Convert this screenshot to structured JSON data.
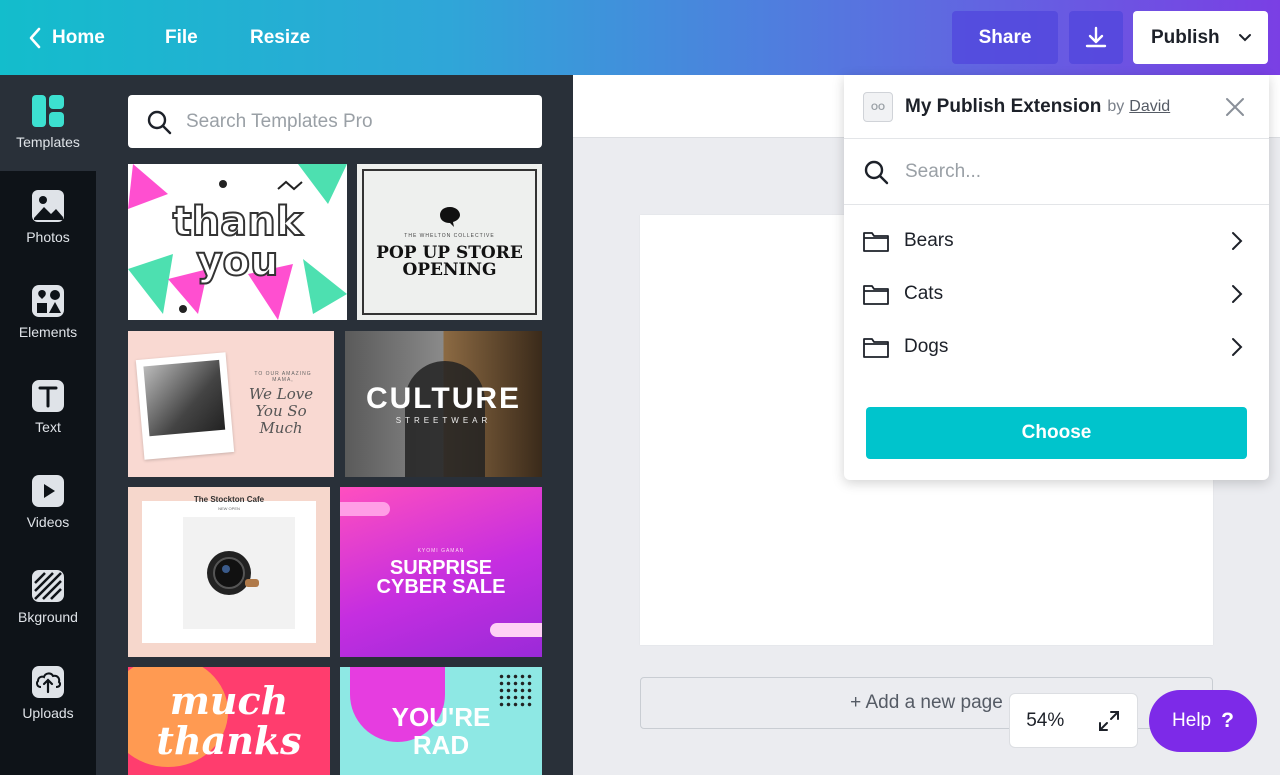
{
  "topbar": {
    "home_label": "Home",
    "file_label": "File",
    "resize_label": "Resize",
    "share_label": "Share",
    "download_icon": "download-icon",
    "publish_label": "Publish"
  },
  "rail": {
    "items": [
      {
        "label": "Templates",
        "icon": "templates-icon"
      },
      {
        "label": "Photos",
        "icon": "photos-icon"
      },
      {
        "label": "Elements",
        "icon": "elements-icon"
      },
      {
        "label": "Text",
        "icon": "text-icon"
      },
      {
        "label": "Videos",
        "icon": "videos-icon"
      },
      {
        "label": "Bkground",
        "icon": "background-icon"
      },
      {
        "label": "Uploads",
        "icon": "uploads-icon"
      }
    ]
  },
  "templates_panel": {
    "search_placeholder": "Search Templates Pro",
    "templates": [
      {
        "text": "thank you"
      },
      {
        "text_small": "THE WHELTON COLLECTIVE",
        "text": "POP UP STORE OPENING"
      },
      {
        "text_small": "TO OUR AMAZING MAMA,",
        "text": "We Love You So Much"
      },
      {
        "text": "CULTURE",
        "text_small": "STREETWEAR"
      },
      {
        "text": "The Stockton Cafe",
        "text_small": "NEW OPEN"
      },
      {
        "text_small": "KYOMI GAMAN",
        "text": "SURPRISE CYBER SALE"
      },
      {
        "text": "much thanks"
      },
      {
        "text": "YOU'RE RAD"
      }
    ]
  },
  "canvas": {
    "add_page_label": "+ Add a new page",
    "zoom_level": "54%"
  },
  "help": {
    "label": "Help",
    "icon_text": "?"
  },
  "extension": {
    "title": "My Publish Extension",
    "by_label": "by",
    "author": "David",
    "logo_text": "OO",
    "search_placeholder": "Search...",
    "folders": [
      {
        "label": "Bears"
      },
      {
        "label": "Cats"
      },
      {
        "label": "Dogs"
      }
    ],
    "choose_label": "Choose"
  },
  "colors": {
    "accent_teal": "#00c4cc",
    "help_purple": "#7d2ae8",
    "panel_dark": "#293039",
    "rail_dark": "#0e1318"
  }
}
